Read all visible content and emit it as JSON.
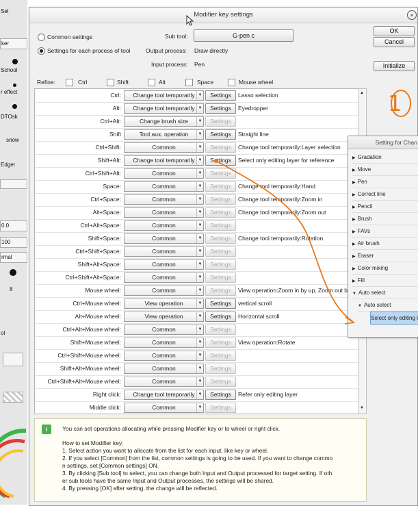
{
  "background": {
    "labels": [
      "Sel",
      "ker",
      "School",
      "r effect",
      "DTOsk",
      "snow",
      "Edger",
      "0.0",
      "100",
      "rmal",
      "8",
      "ol"
    ]
  },
  "dialog": {
    "title": "Modifier key settings",
    "radio_common": "Common settings",
    "radio_each": "Settings for each process of tool",
    "sub_tool_label": "Sub tool:",
    "sub_tool_value": "G-pen c",
    "output_process_label": "Output process:",
    "output_process_value": "Draw directly",
    "input_process_label": "Input process:",
    "input_process_value": "Pen",
    "ok": "OK",
    "cancel": "Cancel",
    "initialize": "Initialize",
    "refine_label": "Refine:",
    "refine": [
      "Ctrl",
      "Shift",
      "Alt",
      "Space",
      "Mouse wheel"
    ]
  },
  "rows": [
    {
      "key": "Ctrl:",
      "op": "Change tool temporarily",
      "settings": "Settings",
      "enabled": true,
      "desc": "Lasso selection"
    },
    {
      "key": "Alt:",
      "op": "Change tool temporarily",
      "settings": "Settings",
      "enabled": true,
      "desc": "Eyedropper"
    },
    {
      "key": "Ctrl+Alt:",
      "op": "Change brush size",
      "settings": "Settings",
      "enabled": false,
      "desc": ""
    },
    {
      "key": "Shift",
      "op": "Tool aux. operation",
      "settings": "Settings",
      "enabled": true,
      "desc": "Straight line"
    },
    {
      "key": "Ctrl+Shift:",
      "op": "Common",
      "settings": "Settings",
      "enabled": false,
      "desc": "Change tool temporarily:Layer selection"
    },
    {
      "key": "Shift+Alt:",
      "op": "Change tool temporarily",
      "settings": "Settings",
      "enabled": true,
      "desc": "Select only editing layer for reference"
    },
    {
      "key": "Ctrl+Shift+Alt:",
      "op": "Common",
      "settings": "Settings",
      "enabled": false,
      "desc": ""
    },
    {
      "key": "Space:",
      "op": "Common",
      "settings": "Settings",
      "enabled": false,
      "desc": "Change tool temporarily:Hand"
    },
    {
      "key": "Ctrl+Space:",
      "op": "Common",
      "settings": "Settings",
      "enabled": false,
      "desc": "Change tool temporarily:Zoom in"
    },
    {
      "key": "Alt+Space:",
      "op": "Common",
      "settings": "Settings",
      "enabled": false,
      "desc": "Change tool temporarily:Zoom out"
    },
    {
      "key": "Ctrl+Alt+Space:",
      "op": "Common",
      "settings": "Settings",
      "enabled": false,
      "desc": ""
    },
    {
      "key": "Shift+Space:",
      "op": "Common",
      "settings": "Settings",
      "enabled": false,
      "desc": "Change tool temporarily:Rotation"
    },
    {
      "key": "Ctrl+Shift+Space:",
      "op": "Common",
      "settings": "Settings",
      "enabled": false,
      "desc": ""
    },
    {
      "key": "Shift+Alt+Space:",
      "op": "Common",
      "settings": "Settings",
      "enabled": false,
      "desc": ""
    },
    {
      "key": "Ctrl+Shift+Alt+Space:",
      "op": "Common",
      "settings": "Settings",
      "enabled": false,
      "desc": ""
    },
    {
      "key": "Mouse wheel:",
      "op": "Common",
      "settings": "Settings",
      "enabled": false,
      "desc": "View operation:Zoom in by up, Zoom out b"
    },
    {
      "key": "Ctrl+Mouse wheel:",
      "op": "View operation",
      "settings": "Settings",
      "enabled": true,
      "desc": "vertical scroll"
    },
    {
      "key": "Alt+Mouse wheel:",
      "op": "View operation",
      "settings": "Settings",
      "enabled": true,
      "desc": "Horizontal scroll"
    },
    {
      "key": "Ctrl+Alt+Mouse wheel:",
      "op": "Common",
      "settings": "Settings",
      "enabled": false,
      "desc": ""
    },
    {
      "key": "Shift+Mouse wheel:",
      "op": "Common",
      "settings": "Settings",
      "enabled": false,
      "desc": "View operation:Rotate"
    },
    {
      "key": "Ctrl+Shift+Mouse wheel:",
      "op": "Common",
      "settings": "Settings",
      "enabled": false,
      "desc": ""
    },
    {
      "key": "Shift+Alt+Mouse wheel:",
      "op": "Common",
      "settings": "Settings",
      "enabled": false,
      "desc": ""
    },
    {
      "key": "Ctrl+Shift+Alt+Mouse wheel:",
      "op": "Common",
      "settings": "Settings",
      "enabled": false,
      "desc": ""
    },
    {
      "key": "Right click:",
      "op": "Change tool temporarily",
      "settings": "Settings",
      "enabled": true,
      "desc": "Refer only editing layer"
    },
    {
      "key": "Middle click:",
      "op": "Common",
      "settings": "Settings",
      "enabled": false,
      "desc": ""
    }
  ],
  "help": {
    "intro": "You can set operations allocating while pressing Modifier key or to wheel or right click.",
    "lines": [
      "How to set Modifier key:",
      "1. Select action you want to allocate from the list for each input, like key or wheel.",
      "2. If you select [Common] from the list, common settings is going to be used. If you want to change commo",
      "n settings, set [Common settings] ON.",
      "3. By clicking [Sub tool] to select, you can change both Input and Output processed for target setting. If oth",
      "er sub tools have the same Input and Output processes, the settings will be shared.",
      "4. By pressing [OK] after setting, the change will be reflected."
    ]
  },
  "annotation": {
    "number": "1",
    "color": "#e8791e"
  },
  "side_panel": {
    "title": "Setting for Chan",
    "items": [
      "Gradation",
      "Move",
      "Pen",
      "Correct line",
      "Pencil",
      "Brush",
      "FAVs",
      "Air brush",
      "Eraser",
      "Color mixing",
      "Fill",
      "Auto select",
      "Auto select",
      "Select only editing la"
    ]
  }
}
